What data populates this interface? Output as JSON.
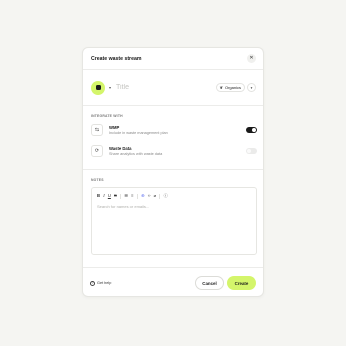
{
  "modal": {
    "title": "Create waste stream",
    "close_icon": "close-icon"
  },
  "title_row": {
    "icon": "waste-stream-icon",
    "title_placeholder": "Title",
    "category": {
      "label": "Organics",
      "icon": "leaf-icon"
    }
  },
  "integrations": {
    "label": "INTEGRATE WITH",
    "items": [
      {
        "name": "WMP",
        "description": "Include in waste management plan",
        "icon": "document-icon",
        "enabled": true
      },
      {
        "name": "Waste Data",
        "description": "Share analytics with waste data",
        "icon": "sync-icon",
        "enabled": false
      }
    ]
  },
  "notes": {
    "label": "NOTES",
    "placeholder": "Search for names or emails...",
    "toolbar": [
      "B",
      "I",
      "U",
      "S",
      "bulleted-list",
      "numbered-list",
      "link",
      "code",
      "attachment",
      "info"
    ]
  },
  "footer": {
    "help_label": "Get help",
    "cancel_label": "Cancel",
    "create_label": "Create"
  },
  "colors": {
    "accent": "#d4f56b",
    "toggle_on": "#1a1a1a",
    "background": "#f5f5f2"
  }
}
